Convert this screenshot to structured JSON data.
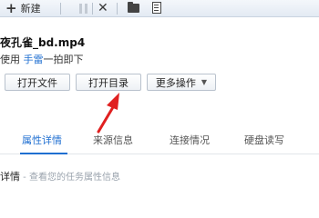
{
  "toolbar": {
    "new_label": "新建",
    "icons": [
      "plus-icon",
      "pause-icon",
      "delete-icon",
      "folder-icon",
      "document-icon"
    ]
  },
  "task": {
    "filename": "夜孔雀_bd.mp4",
    "subtitle_prefix": "使用 ",
    "subtitle_link": "手雷",
    "subtitle_suffix": "一拍即下"
  },
  "actions": {
    "open_file": "打开文件",
    "open_folder": "打开目录",
    "more": "更多操作"
  },
  "tabs": [
    {
      "label": "属性详情",
      "active": true
    },
    {
      "label": "来源信息",
      "active": false
    },
    {
      "label": "连接情况",
      "active": false
    },
    {
      "label": "硬盘读写",
      "active": false
    }
  ],
  "detail": {
    "title": "详情",
    "hint": " - 查看您的任务属性信息"
  },
  "colors": {
    "accent": "#1f6fd1",
    "arrow": "#e02020"
  }
}
